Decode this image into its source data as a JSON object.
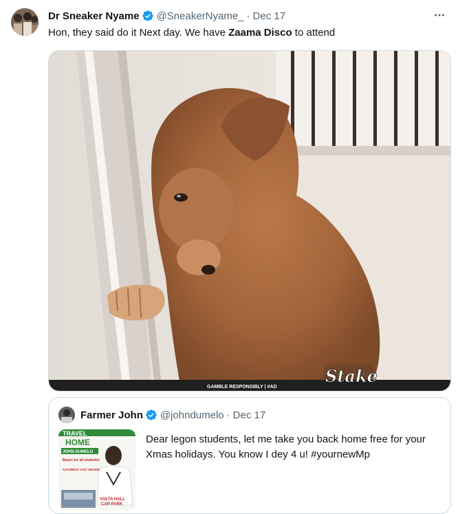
{
  "tweet": {
    "author_name": "Dr Sneaker Nyame",
    "handle": "@SneakerNyame_",
    "separator": "·",
    "date": "Dec 17",
    "text_part1": "Hon, they said do it Next day. We have ",
    "text_bold": "Zaama Disco",
    "text_part2": " to attend",
    "media": {
      "banner_text": "GAMBLE RESPONSIBLY | #AD",
      "logo_text": "Stake"
    }
  },
  "quote": {
    "author_name": "Farmer John",
    "handle": "@johndumelo",
    "separator": "·",
    "date": "Dec 17",
    "text": "Dear legon students, let me take you back home free for your Xmas holidays. You know I dey 4 u! #yournewMp",
    "thumbnail": {
      "title_1": "TRAVEL",
      "title_2": "HOME",
      "name_banner": "JOHN DUMELO",
      "tag": "Buses for all students!",
      "date_text": "SATURDAY 21ST DECEMBER, 2024",
      "location_1": "VOLTA HALL",
      "location_2": "CAR PARK"
    }
  },
  "colors": {
    "verified": "#1d9bf0",
    "text_primary": "#0f1419",
    "text_secondary": "#536471",
    "border": "#cfd9de"
  },
  "icons": {
    "verified": "verified-badge-icon",
    "more": "more-options-icon"
  }
}
